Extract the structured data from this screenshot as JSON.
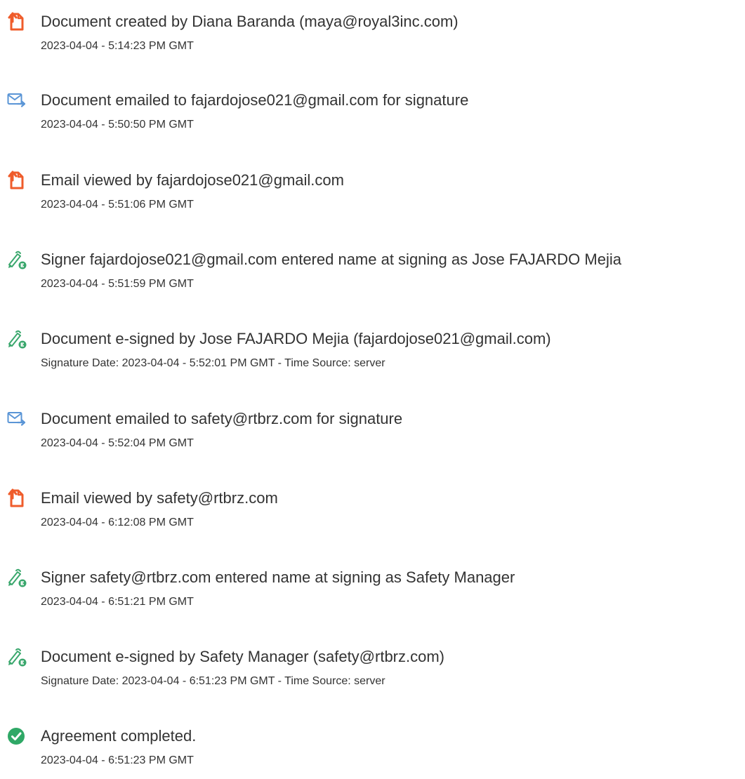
{
  "colors": {
    "document_icon": "#ef5c2b",
    "email_icon": "#5a95d6",
    "sign_icon": "#3aa76d",
    "complete_icon": "#2fa866",
    "text": "#333333"
  },
  "events": [
    {
      "icon": "document-icon",
      "title": "Document created by Diana Baranda (maya@royal3inc.com)",
      "detail": "2023-04-04 - 5:14:23 PM GMT"
    },
    {
      "icon": "email-icon",
      "title": "Document emailed to fajardojose021@gmail.com for signature",
      "detail": "2023-04-04 - 5:50:50 PM GMT"
    },
    {
      "icon": "document-icon",
      "title": "Email viewed by fajardojose021@gmail.com",
      "detail": "2023-04-04 - 5:51:06 PM GMT"
    },
    {
      "icon": "sign-icon",
      "title": "Signer fajardojose021@gmail.com entered name at signing as Jose FAJARDO Mejia",
      "detail": "2023-04-04 - 5:51:59 PM GMT"
    },
    {
      "icon": "sign-icon",
      "title": "Document e-signed by Jose FAJARDO Mejia (fajardojose021@gmail.com)",
      "detail": "Signature Date: 2023-04-04 - 5:52:01 PM GMT - Time Source: server"
    },
    {
      "icon": "email-icon",
      "title": "Document emailed to safety@rtbrz.com for signature",
      "detail": "2023-04-04 - 5:52:04 PM GMT"
    },
    {
      "icon": "document-icon",
      "title": "Email viewed by safety@rtbrz.com",
      "detail": "2023-04-04 - 6:12:08 PM GMT"
    },
    {
      "icon": "sign-icon",
      "title": "Signer safety@rtbrz.com entered name at signing as Safety Manager",
      "detail": "2023-04-04 - 6:51:21 PM GMT"
    },
    {
      "icon": "sign-icon",
      "title": "Document e-signed by Safety Manager (safety@rtbrz.com)",
      "detail": "Signature Date: 2023-04-04 - 6:51:23 PM GMT - Time Source: server"
    },
    {
      "icon": "check-circle-icon",
      "title": "Agreement completed.",
      "detail": "2023-04-04 - 6:51:23 PM GMT"
    }
  ]
}
